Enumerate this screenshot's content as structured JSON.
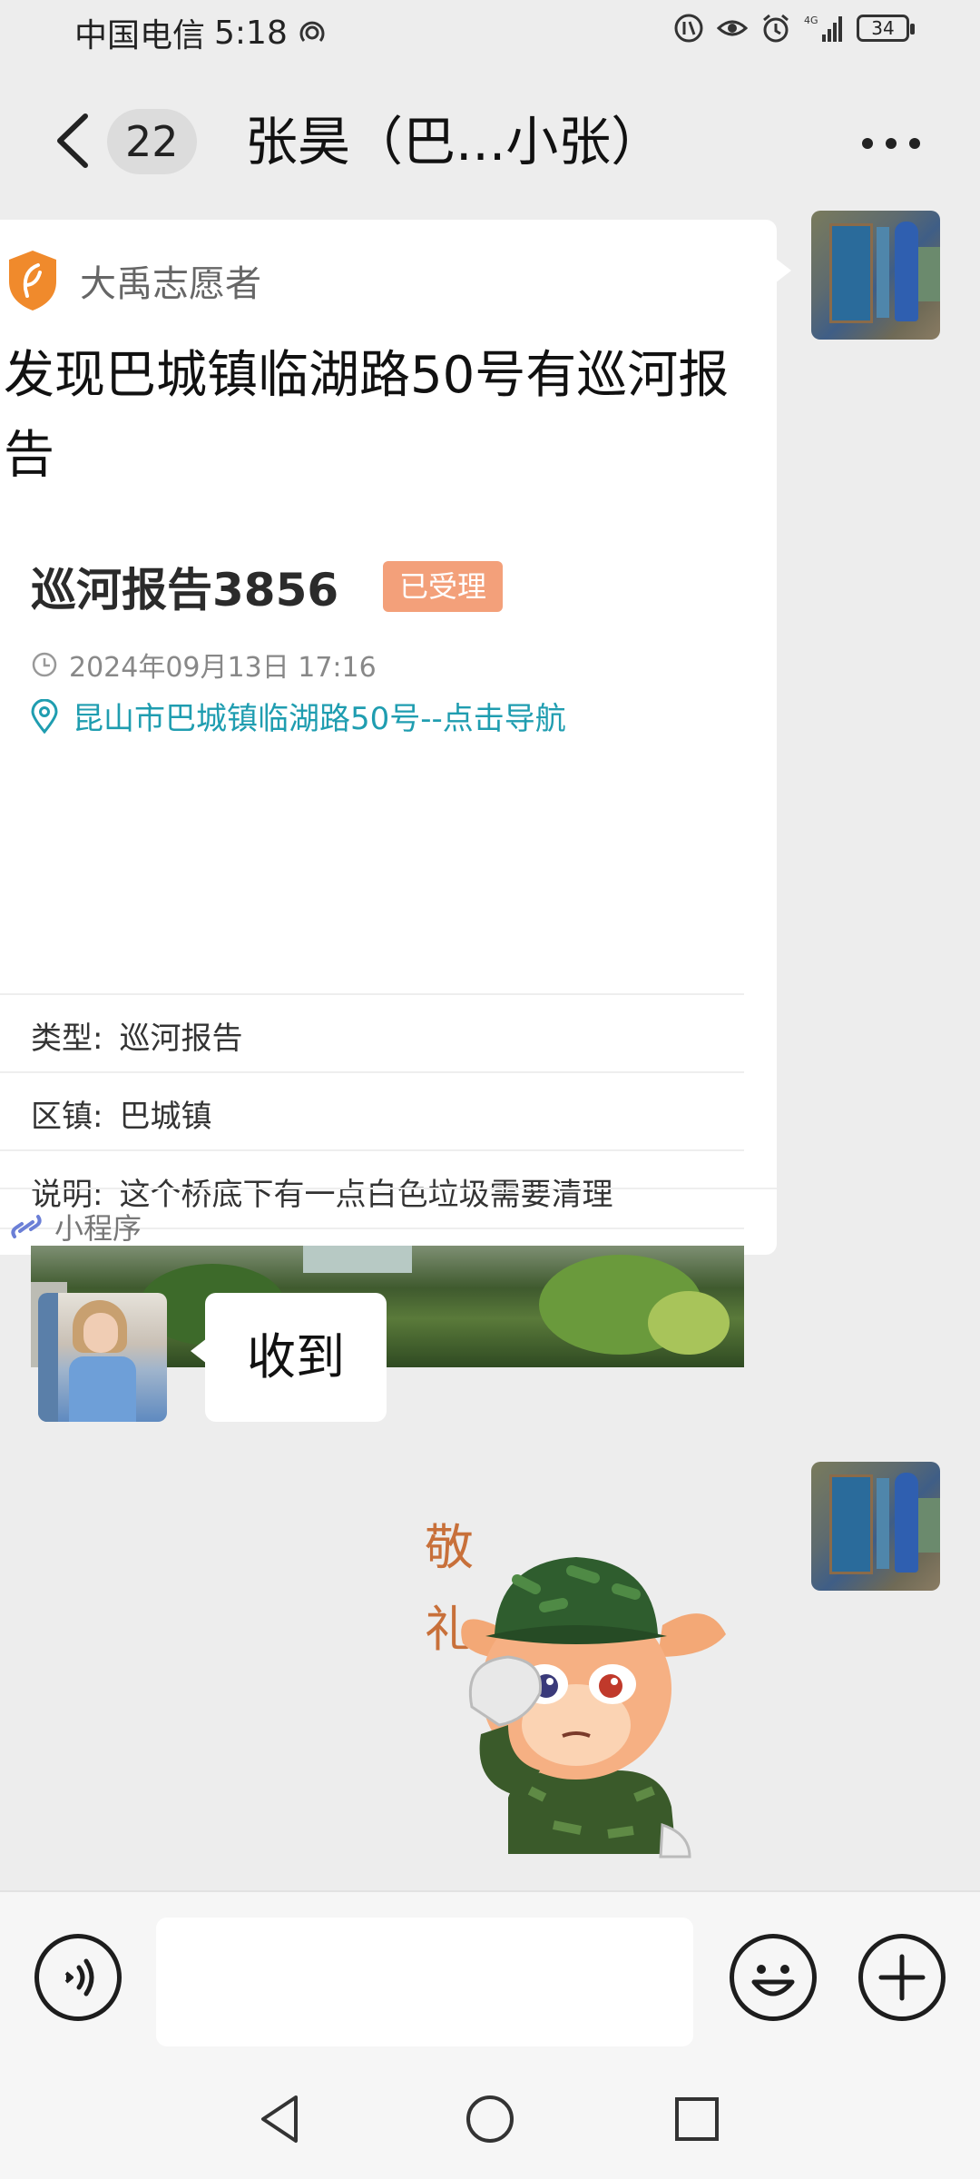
{
  "status_bar": {
    "carrier": "中国电信",
    "time": "5:18",
    "battery": "34"
  },
  "header": {
    "back_label": "返回",
    "unread_count": "22",
    "title": "张昊（巴...小张）"
  },
  "mini_program_card": {
    "source_name": "大禹志愿者",
    "title": "发现巴城镇临湖路50号有巡河报告",
    "report": {
      "heading": "巡河报告3856",
      "status_badge": "已受理",
      "datetime": "2024年09月13日 17:16",
      "location": "昆山市巴城镇临湖路50号--点击导航",
      "rows": [
        {
          "key": "类型:",
          "value": "巡河报告"
        },
        {
          "key": "区镇:",
          "value": "巴城镇"
        },
        {
          "key": "说明:",
          "value": "这个桥底下有一点白色垃圾需要清理"
        }
      ]
    },
    "footer_label": "小程序"
  },
  "messages": [
    {
      "direction": "in",
      "text": "收到"
    }
  ],
  "sticker": {
    "text_lines": [
      "敬",
      "礼"
    ]
  },
  "input_bar": {
    "text_value": "",
    "placeholder": ""
  },
  "icons": {
    "voice": "voice-icon",
    "emoji": "emoji-icon",
    "plus": "plus-icon",
    "nav_back": "nav-back-icon",
    "nav_home": "nav-home-icon",
    "nav_recent": "nav-recent-icon"
  },
  "colors": {
    "chat_bg": "#ededed",
    "badge_bg": "#f3a07a",
    "location_link": "#1f9db0",
    "logo_orange": "#f08a2c"
  }
}
